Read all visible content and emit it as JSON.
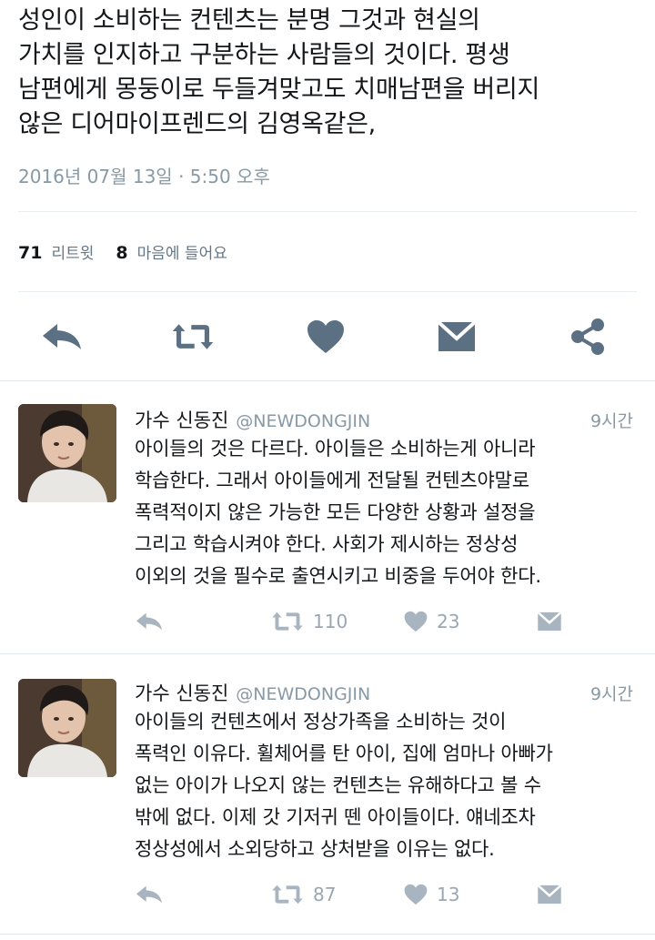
{
  "main_tweet": {
    "text": "성인이 소비하는 컨텐츠는 분명 그것과 현실의\n가치를 인지하고 구분하는 사람들의 것이다. 평생\n남편에게 몽둥이로 두들겨맞고도 치매남편을 버리지\n않은 디어마이프렌드의 김영옥같은,",
    "timestamp": "2016년 07월 13일 · 5:50 오후",
    "retweet_count": "71",
    "retweet_label": "리트윗",
    "like_count": "8",
    "like_label": "마음에 들어요",
    "icons": [
      "reply-icon",
      "retweet-icon",
      "heart-icon",
      "message-icon",
      "share-icon"
    ]
  },
  "replies": [
    {
      "name": "가수 신동진",
      "handle": "@NEWDONGJIN",
      "time": "9시간",
      "text": "아이들의 것은 다르다. 아이들은 소비하는게 아니라\n학습한다. 그래서 아이들에게 전달될 컨텐츠야말로\n폭력적이지 않은 가능한 모든 다양한 상황과 설정을\n그리고 학습시켜야 한다. 사회가 제시하는 정상성\n이외의 것을 필수로 출연시키고 비중을 두어야 한다.",
      "retweets": "110",
      "likes": "23"
    },
    {
      "name": "가수 신동진",
      "handle": "@NEWDONGJIN",
      "time": "9시간",
      "text": "아이들의 컨텐츠에서 정상가족을 소비하는 것이\n폭력인 이유다. 휠체어를 탄 아이, 집에 엄마나 아빠가\n없는 아이가 나오지 않는 컨텐츠는 유해하다고 볼 수\n밖에 없다. 이제 갓 기저귀 뗀 아이들이다. 얘네조차\n정상성에서 소외당하고 상처받을 이유는 없다.",
      "retweets": "87",
      "likes": "13"
    }
  ],
  "colors": {
    "icon_main": "#5b7083",
    "icon_reply": "#a8b4bf",
    "text_muted": "#8899a6"
  }
}
